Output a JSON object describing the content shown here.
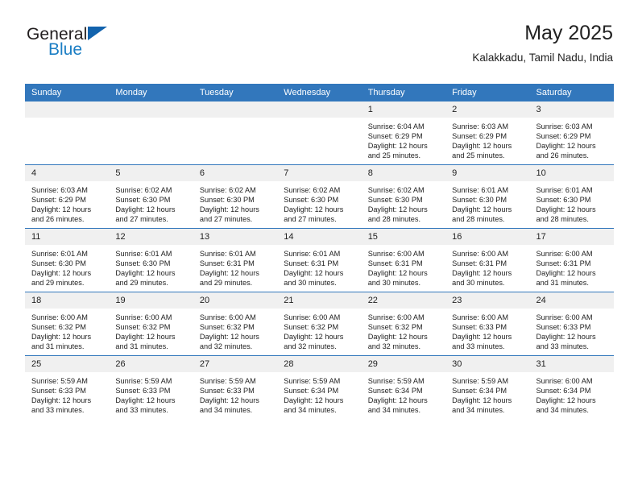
{
  "brand": {
    "name_top": "General",
    "name_bottom": "Blue",
    "accent_color": "#1b7ec4",
    "triangle_color": "#1263ad"
  },
  "header": {
    "title": "May 2025",
    "subtitle": "Kalakkadu, Tamil Nadu, India"
  },
  "theme": {
    "header_bg": "#3277bc",
    "header_text": "#ffffff",
    "daynum_bg": "#f0f0f0",
    "cell_bg": "#ffffff",
    "row_divider": "#3277bc"
  },
  "weekdays": [
    "Sunday",
    "Monday",
    "Tuesday",
    "Wednesday",
    "Thursday",
    "Friday",
    "Saturday"
  ],
  "weeks": [
    [
      {
        "day": "",
        "sunrise": "",
        "sunset": "",
        "daylight_line1": "",
        "daylight_line2": ""
      },
      {
        "day": "",
        "sunrise": "",
        "sunset": "",
        "daylight_line1": "",
        "daylight_line2": ""
      },
      {
        "day": "",
        "sunrise": "",
        "sunset": "",
        "daylight_line1": "",
        "daylight_line2": ""
      },
      {
        "day": "",
        "sunrise": "",
        "sunset": "",
        "daylight_line1": "",
        "daylight_line2": ""
      },
      {
        "day": "1",
        "sunrise": "Sunrise: 6:04 AM",
        "sunset": "Sunset: 6:29 PM",
        "daylight_line1": "Daylight: 12 hours",
        "daylight_line2": "and 25 minutes."
      },
      {
        "day": "2",
        "sunrise": "Sunrise: 6:03 AM",
        "sunset": "Sunset: 6:29 PM",
        "daylight_line1": "Daylight: 12 hours",
        "daylight_line2": "and 25 minutes."
      },
      {
        "day": "3",
        "sunrise": "Sunrise: 6:03 AM",
        "sunset": "Sunset: 6:29 PM",
        "daylight_line1": "Daylight: 12 hours",
        "daylight_line2": "and 26 minutes."
      }
    ],
    [
      {
        "day": "4",
        "sunrise": "Sunrise: 6:03 AM",
        "sunset": "Sunset: 6:29 PM",
        "daylight_line1": "Daylight: 12 hours",
        "daylight_line2": "and 26 minutes."
      },
      {
        "day": "5",
        "sunrise": "Sunrise: 6:02 AM",
        "sunset": "Sunset: 6:30 PM",
        "daylight_line1": "Daylight: 12 hours",
        "daylight_line2": "and 27 minutes."
      },
      {
        "day": "6",
        "sunrise": "Sunrise: 6:02 AM",
        "sunset": "Sunset: 6:30 PM",
        "daylight_line1": "Daylight: 12 hours",
        "daylight_line2": "and 27 minutes."
      },
      {
        "day": "7",
        "sunrise": "Sunrise: 6:02 AM",
        "sunset": "Sunset: 6:30 PM",
        "daylight_line1": "Daylight: 12 hours",
        "daylight_line2": "and 27 minutes."
      },
      {
        "day": "8",
        "sunrise": "Sunrise: 6:02 AM",
        "sunset": "Sunset: 6:30 PM",
        "daylight_line1": "Daylight: 12 hours",
        "daylight_line2": "and 28 minutes."
      },
      {
        "day": "9",
        "sunrise": "Sunrise: 6:01 AM",
        "sunset": "Sunset: 6:30 PM",
        "daylight_line1": "Daylight: 12 hours",
        "daylight_line2": "and 28 minutes."
      },
      {
        "day": "10",
        "sunrise": "Sunrise: 6:01 AM",
        "sunset": "Sunset: 6:30 PM",
        "daylight_line1": "Daylight: 12 hours",
        "daylight_line2": "and 28 minutes."
      }
    ],
    [
      {
        "day": "11",
        "sunrise": "Sunrise: 6:01 AM",
        "sunset": "Sunset: 6:30 PM",
        "daylight_line1": "Daylight: 12 hours",
        "daylight_line2": "and 29 minutes."
      },
      {
        "day": "12",
        "sunrise": "Sunrise: 6:01 AM",
        "sunset": "Sunset: 6:30 PM",
        "daylight_line1": "Daylight: 12 hours",
        "daylight_line2": "and 29 minutes."
      },
      {
        "day": "13",
        "sunrise": "Sunrise: 6:01 AM",
        "sunset": "Sunset: 6:31 PM",
        "daylight_line1": "Daylight: 12 hours",
        "daylight_line2": "and 29 minutes."
      },
      {
        "day": "14",
        "sunrise": "Sunrise: 6:01 AM",
        "sunset": "Sunset: 6:31 PM",
        "daylight_line1": "Daylight: 12 hours",
        "daylight_line2": "and 30 minutes."
      },
      {
        "day": "15",
        "sunrise": "Sunrise: 6:00 AM",
        "sunset": "Sunset: 6:31 PM",
        "daylight_line1": "Daylight: 12 hours",
        "daylight_line2": "and 30 minutes."
      },
      {
        "day": "16",
        "sunrise": "Sunrise: 6:00 AM",
        "sunset": "Sunset: 6:31 PM",
        "daylight_line1": "Daylight: 12 hours",
        "daylight_line2": "and 30 minutes."
      },
      {
        "day": "17",
        "sunrise": "Sunrise: 6:00 AM",
        "sunset": "Sunset: 6:31 PM",
        "daylight_line1": "Daylight: 12 hours",
        "daylight_line2": "and 31 minutes."
      }
    ],
    [
      {
        "day": "18",
        "sunrise": "Sunrise: 6:00 AM",
        "sunset": "Sunset: 6:32 PM",
        "daylight_line1": "Daylight: 12 hours",
        "daylight_line2": "and 31 minutes."
      },
      {
        "day": "19",
        "sunrise": "Sunrise: 6:00 AM",
        "sunset": "Sunset: 6:32 PM",
        "daylight_line1": "Daylight: 12 hours",
        "daylight_line2": "and 31 minutes."
      },
      {
        "day": "20",
        "sunrise": "Sunrise: 6:00 AM",
        "sunset": "Sunset: 6:32 PM",
        "daylight_line1": "Daylight: 12 hours",
        "daylight_line2": "and 32 minutes."
      },
      {
        "day": "21",
        "sunrise": "Sunrise: 6:00 AM",
        "sunset": "Sunset: 6:32 PM",
        "daylight_line1": "Daylight: 12 hours",
        "daylight_line2": "and 32 minutes."
      },
      {
        "day": "22",
        "sunrise": "Sunrise: 6:00 AM",
        "sunset": "Sunset: 6:32 PM",
        "daylight_line1": "Daylight: 12 hours",
        "daylight_line2": "and 32 minutes."
      },
      {
        "day": "23",
        "sunrise": "Sunrise: 6:00 AM",
        "sunset": "Sunset: 6:33 PM",
        "daylight_line1": "Daylight: 12 hours",
        "daylight_line2": "and 33 minutes."
      },
      {
        "day": "24",
        "sunrise": "Sunrise: 6:00 AM",
        "sunset": "Sunset: 6:33 PM",
        "daylight_line1": "Daylight: 12 hours",
        "daylight_line2": "and 33 minutes."
      }
    ],
    [
      {
        "day": "25",
        "sunrise": "Sunrise: 5:59 AM",
        "sunset": "Sunset: 6:33 PM",
        "daylight_line1": "Daylight: 12 hours",
        "daylight_line2": "and 33 minutes."
      },
      {
        "day": "26",
        "sunrise": "Sunrise: 5:59 AM",
        "sunset": "Sunset: 6:33 PM",
        "daylight_line1": "Daylight: 12 hours",
        "daylight_line2": "and 33 minutes."
      },
      {
        "day": "27",
        "sunrise": "Sunrise: 5:59 AM",
        "sunset": "Sunset: 6:33 PM",
        "daylight_line1": "Daylight: 12 hours",
        "daylight_line2": "and 34 minutes."
      },
      {
        "day": "28",
        "sunrise": "Sunrise: 5:59 AM",
        "sunset": "Sunset: 6:34 PM",
        "daylight_line1": "Daylight: 12 hours",
        "daylight_line2": "and 34 minutes."
      },
      {
        "day": "29",
        "sunrise": "Sunrise: 5:59 AM",
        "sunset": "Sunset: 6:34 PM",
        "daylight_line1": "Daylight: 12 hours",
        "daylight_line2": "and 34 minutes."
      },
      {
        "day": "30",
        "sunrise": "Sunrise: 5:59 AM",
        "sunset": "Sunset: 6:34 PM",
        "daylight_line1": "Daylight: 12 hours",
        "daylight_line2": "and 34 minutes."
      },
      {
        "day": "31",
        "sunrise": "Sunrise: 6:00 AM",
        "sunset": "Sunset: 6:34 PM",
        "daylight_line1": "Daylight: 12 hours",
        "daylight_line2": "and 34 minutes."
      }
    ]
  ]
}
